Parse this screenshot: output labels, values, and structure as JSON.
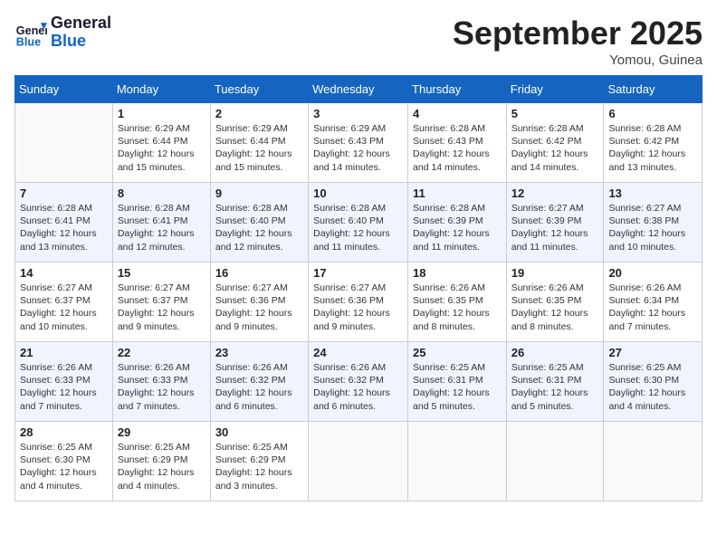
{
  "header": {
    "logo_line1": "General",
    "logo_line2": "Blue",
    "month": "September 2025",
    "location": "Yomou, Guinea"
  },
  "days_of_week": [
    "Sunday",
    "Monday",
    "Tuesday",
    "Wednesday",
    "Thursday",
    "Friday",
    "Saturday"
  ],
  "weeks": [
    [
      {
        "day": "",
        "info": ""
      },
      {
        "day": "1",
        "info": "Sunrise: 6:29 AM\nSunset: 6:44 PM\nDaylight: 12 hours\nand 15 minutes."
      },
      {
        "day": "2",
        "info": "Sunrise: 6:29 AM\nSunset: 6:44 PM\nDaylight: 12 hours\nand 15 minutes."
      },
      {
        "day": "3",
        "info": "Sunrise: 6:29 AM\nSunset: 6:43 PM\nDaylight: 12 hours\nand 14 minutes."
      },
      {
        "day": "4",
        "info": "Sunrise: 6:28 AM\nSunset: 6:43 PM\nDaylight: 12 hours\nand 14 minutes."
      },
      {
        "day": "5",
        "info": "Sunrise: 6:28 AM\nSunset: 6:42 PM\nDaylight: 12 hours\nand 14 minutes."
      },
      {
        "day": "6",
        "info": "Sunrise: 6:28 AM\nSunset: 6:42 PM\nDaylight: 12 hours\nand 13 minutes."
      }
    ],
    [
      {
        "day": "7",
        "info": "Sunrise: 6:28 AM\nSunset: 6:41 PM\nDaylight: 12 hours\nand 13 minutes."
      },
      {
        "day": "8",
        "info": "Sunrise: 6:28 AM\nSunset: 6:41 PM\nDaylight: 12 hours\nand 12 minutes."
      },
      {
        "day": "9",
        "info": "Sunrise: 6:28 AM\nSunset: 6:40 PM\nDaylight: 12 hours\nand 12 minutes."
      },
      {
        "day": "10",
        "info": "Sunrise: 6:28 AM\nSunset: 6:40 PM\nDaylight: 12 hours\nand 11 minutes."
      },
      {
        "day": "11",
        "info": "Sunrise: 6:28 AM\nSunset: 6:39 PM\nDaylight: 12 hours\nand 11 minutes."
      },
      {
        "day": "12",
        "info": "Sunrise: 6:27 AM\nSunset: 6:39 PM\nDaylight: 12 hours\nand 11 minutes."
      },
      {
        "day": "13",
        "info": "Sunrise: 6:27 AM\nSunset: 6:38 PM\nDaylight: 12 hours\nand 10 minutes."
      }
    ],
    [
      {
        "day": "14",
        "info": "Sunrise: 6:27 AM\nSunset: 6:37 PM\nDaylight: 12 hours\nand 10 minutes."
      },
      {
        "day": "15",
        "info": "Sunrise: 6:27 AM\nSunset: 6:37 PM\nDaylight: 12 hours\nand 9 minutes."
      },
      {
        "day": "16",
        "info": "Sunrise: 6:27 AM\nSunset: 6:36 PM\nDaylight: 12 hours\nand 9 minutes."
      },
      {
        "day": "17",
        "info": "Sunrise: 6:27 AM\nSunset: 6:36 PM\nDaylight: 12 hours\nand 9 minutes."
      },
      {
        "day": "18",
        "info": "Sunrise: 6:26 AM\nSunset: 6:35 PM\nDaylight: 12 hours\nand 8 minutes."
      },
      {
        "day": "19",
        "info": "Sunrise: 6:26 AM\nSunset: 6:35 PM\nDaylight: 12 hours\nand 8 minutes."
      },
      {
        "day": "20",
        "info": "Sunrise: 6:26 AM\nSunset: 6:34 PM\nDaylight: 12 hours\nand 7 minutes."
      }
    ],
    [
      {
        "day": "21",
        "info": "Sunrise: 6:26 AM\nSunset: 6:33 PM\nDaylight: 12 hours\nand 7 minutes."
      },
      {
        "day": "22",
        "info": "Sunrise: 6:26 AM\nSunset: 6:33 PM\nDaylight: 12 hours\nand 7 minutes."
      },
      {
        "day": "23",
        "info": "Sunrise: 6:26 AM\nSunset: 6:32 PM\nDaylight: 12 hours\nand 6 minutes."
      },
      {
        "day": "24",
        "info": "Sunrise: 6:26 AM\nSunset: 6:32 PM\nDaylight: 12 hours\nand 6 minutes."
      },
      {
        "day": "25",
        "info": "Sunrise: 6:25 AM\nSunset: 6:31 PM\nDaylight: 12 hours\nand 5 minutes."
      },
      {
        "day": "26",
        "info": "Sunrise: 6:25 AM\nSunset: 6:31 PM\nDaylight: 12 hours\nand 5 minutes."
      },
      {
        "day": "27",
        "info": "Sunrise: 6:25 AM\nSunset: 6:30 PM\nDaylight: 12 hours\nand 4 minutes."
      }
    ],
    [
      {
        "day": "28",
        "info": "Sunrise: 6:25 AM\nSunset: 6:30 PM\nDaylight: 12 hours\nand 4 minutes."
      },
      {
        "day": "29",
        "info": "Sunrise: 6:25 AM\nSunset: 6:29 PM\nDaylight: 12 hours\nand 4 minutes."
      },
      {
        "day": "30",
        "info": "Sunrise: 6:25 AM\nSunset: 6:29 PM\nDaylight: 12 hours\nand 3 minutes."
      },
      {
        "day": "",
        "info": ""
      },
      {
        "day": "",
        "info": ""
      },
      {
        "day": "",
        "info": ""
      },
      {
        "day": "",
        "info": ""
      }
    ]
  ]
}
